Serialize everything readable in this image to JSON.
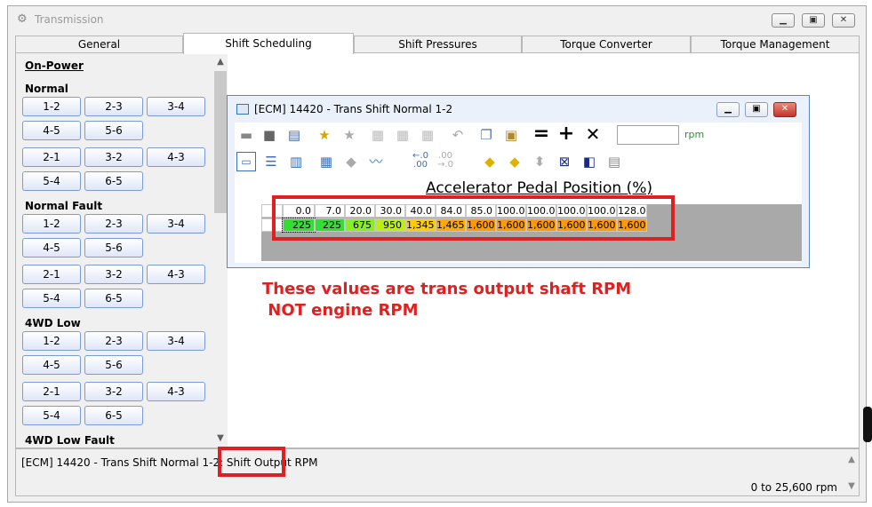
{
  "window": {
    "title": "Transmission"
  },
  "tabs": [
    {
      "label": "General"
    },
    {
      "label": "Shift Scheduling"
    },
    {
      "label": "Shift Pressures"
    },
    {
      "label": "Torque Converter"
    },
    {
      "label": "Torque Management"
    }
  ],
  "sidebar": {
    "on_power": "On-Power",
    "sections": [
      {
        "title": "Normal",
        "up": [
          "1-2",
          "2-3",
          "3-4",
          "4-5",
          "5-6"
        ],
        "down": [
          "2-1",
          "3-2",
          "4-3",
          "5-4",
          "6-5"
        ]
      },
      {
        "title": "Normal Fault",
        "up": [
          "1-2",
          "2-3",
          "3-4",
          "4-5",
          "5-6"
        ],
        "down": [
          "2-1",
          "3-2",
          "4-3",
          "5-4",
          "6-5"
        ]
      },
      {
        "title": "4WD Low",
        "up": [
          "1-2",
          "2-3",
          "3-4",
          "4-5",
          "5-6"
        ],
        "down": [
          "2-1",
          "3-2",
          "4-3",
          "5-4",
          "6-5"
        ]
      },
      {
        "title": "4WD Low Fault"
      }
    ]
  },
  "editor": {
    "title": "[ECM] 14420 - Trans Shift Normal 1-2",
    "unit_label": "rpm",
    "value_input": "",
    "axis_title": "Accelerator Pedal Position (%)",
    "axis_values": [
      "0.0",
      "7.0",
      "20.0",
      "30.0",
      "40.0",
      "84.0",
      "85.0",
      "100.0",
      "100.0",
      "100.0",
      "100.0",
      "128.0"
    ],
    "row_values": [
      "225",
      "225",
      "675",
      "950",
      "1,345",
      "1,465",
      "1,600",
      "1,600",
      "1,600",
      "1,600",
      "1,600",
      "1,600"
    ],
    "cell_colors": [
      "#33dd33",
      "#33dd33",
      "#88ee22",
      "#bbee11",
      "#ffcc00",
      "#ffaa00",
      "#ff9900",
      "#ff9900",
      "#ff9900",
      "#ff9900",
      "#ff9900",
      "#ff9900"
    ]
  },
  "annotation": {
    "line1": "These values are trans output shaft RPM",
    "line2": " NOT engine RPM",
    "color": "#e02020"
  },
  "status": {
    "description_prefix": "[ECM] 14420 - Trans Shift Normal 1-2: Shift ",
    "description_highlight": "Output RPM",
    "range": "0 to 25,600 rpm"
  }
}
